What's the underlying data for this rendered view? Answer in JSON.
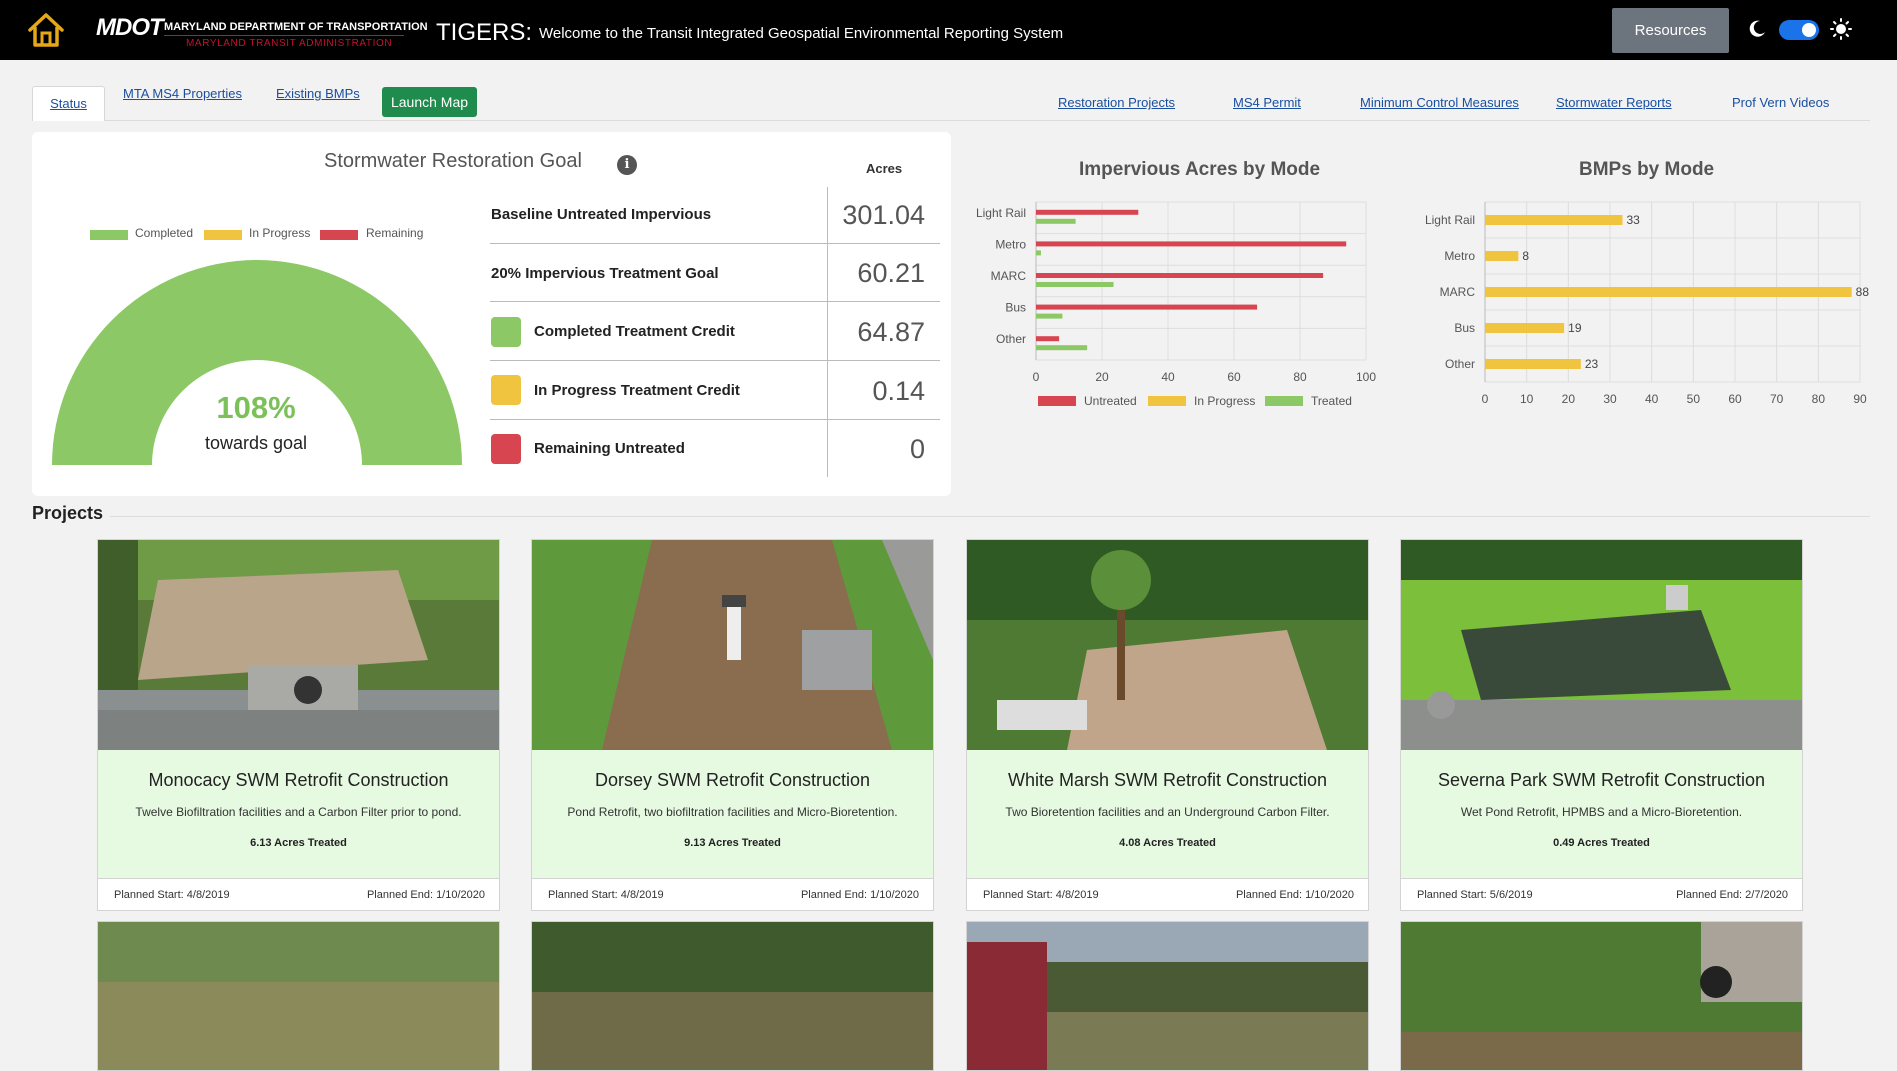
{
  "header": {
    "logo_word": "MDOT",
    "logo_line1": "MARYLAND DEPARTMENT OF TRANSPORTATION",
    "logo_line2": "MARYLAND TRANSIT ADMINISTRATION",
    "brand": "TIGERS:",
    "welcome": "Welcome to the Transit Integrated Geospatial Environmental Reporting System",
    "resources_label": "Resources",
    "theme_toggle_on": true
  },
  "tabs": {
    "status": "Status",
    "properties": "MTA MS4 Properties",
    "bmps": "Existing BMPs",
    "launch_map": "Launch Map",
    "restoration": "Restoration Projects",
    "permit": "MS4 Permit",
    "mcm": "Minimum Control Measures",
    "reports": "Stormwater Reports",
    "videos": "Prof Vern Videos"
  },
  "goal": {
    "title": "Stormwater Restoration Goal",
    "info_icon": "i",
    "acres_header": "Acres",
    "legend": [
      "Completed",
      "In Progress",
      "Remaining"
    ],
    "percent": "108%",
    "towards": "towards goal",
    "rows": [
      {
        "label": "Baseline Untreated Impervious",
        "value": "301.04"
      },
      {
        "label": "20% Impervious Treatment Goal",
        "value": "60.21"
      },
      {
        "label": "Completed Treatment Credit",
        "value": "64.87"
      },
      {
        "label": "In Progress Treatment Credit",
        "value": "0.14"
      },
      {
        "label": "Remaining Untreated",
        "value": "0"
      }
    ],
    "colors": {
      "completed": "#8cc966",
      "in_progress": "#f0c43f",
      "remaining": "#d64550"
    }
  },
  "chart_data": [
    {
      "type": "bar",
      "orientation": "horizontal",
      "title": "Impervious Acres by Mode",
      "categories": [
        "Light Rail",
        "Metro",
        "MARC",
        "Bus",
        "Other"
      ],
      "series": [
        {
          "name": "Untreated",
          "color": "#d64550",
          "values": [
            31,
            94,
            87,
            67,
            7
          ]
        },
        {
          "name": "In Progress",
          "color": "#f0c43f",
          "values": [
            0,
            0,
            0,
            0,
            0
          ]
        },
        {
          "name": "Treated",
          "color": "#8cc966",
          "values": [
            12,
            1.5,
            23.5,
            8,
            15.5
          ]
        }
      ],
      "xlim": [
        0,
        100
      ],
      "xticks": [
        "0",
        "20",
        "40",
        "60",
        "80",
        "100"
      ],
      "grid": true,
      "legend": "bottom"
    },
    {
      "type": "bar",
      "orientation": "horizontal",
      "title": "BMPs by Mode",
      "categories": [
        "Light Rail",
        "Metro",
        "MARC",
        "Bus",
        "Other"
      ],
      "series": [
        {
          "color": "#f0c43f",
          "values": [
            33,
            8,
            88,
            19,
            23
          ]
        }
      ],
      "data_labels": [
        "33",
        "8",
        "88",
        "19",
        "23"
      ],
      "xlim": [
        0,
        90
      ],
      "xticks": [
        "0",
        "10",
        "20",
        "30",
        "40",
        "50",
        "60",
        "70",
        "80",
        "90"
      ],
      "grid": true
    }
  ],
  "projects": {
    "heading": "Projects",
    "cards": [
      {
        "title": "Monocacy SWM Retrofit Construction",
        "desc": "Twelve Biofiltration facilities and a Carbon Filter prior to pond.",
        "acres": "6.13 Acres Treated",
        "start": "Planned Start: 4/8/2019",
        "end": "Planned End: 1/10/2020"
      },
      {
        "title": "Dorsey SWM Retrofit Construction",
        "desc": "Pond Retrofit, two biofiltration facilities and Micro-Bioretention.",
        "acres": "9.13 Acres Treated",
        "start": "Planned Start: 4/8/2019",
        "end": "Planned End: 1/10/2020"
      },
      {
        "title": "White Marsh SWM Retrofit Construction",
        "desc": "Two Bioretention facilities and an Underground Carbon Filter.",
        "acres": "4.08 Acres Treated",
        "start": "Planned Start: 4/8/2019",
        "end": "Planned End: 1/10/2020"
      },
      {
        "title": "Severna Park SWM Retrofit Construction",
        "desc": "Wet Pond Retrofit, HPMBS and a Micro-Bioretention.",
        "acres": "0.49 Acres Treated",
        "start": "Planned Start: 5/6/2019",
        "end": "Planned End: 2/7/2020"
      }
    ]
  },
  "icons": {
    "home": "home-icon",
    "moon": "moon-icon",
    "sun": "sun-icon",
    "info": "info-icon"
  }
}
